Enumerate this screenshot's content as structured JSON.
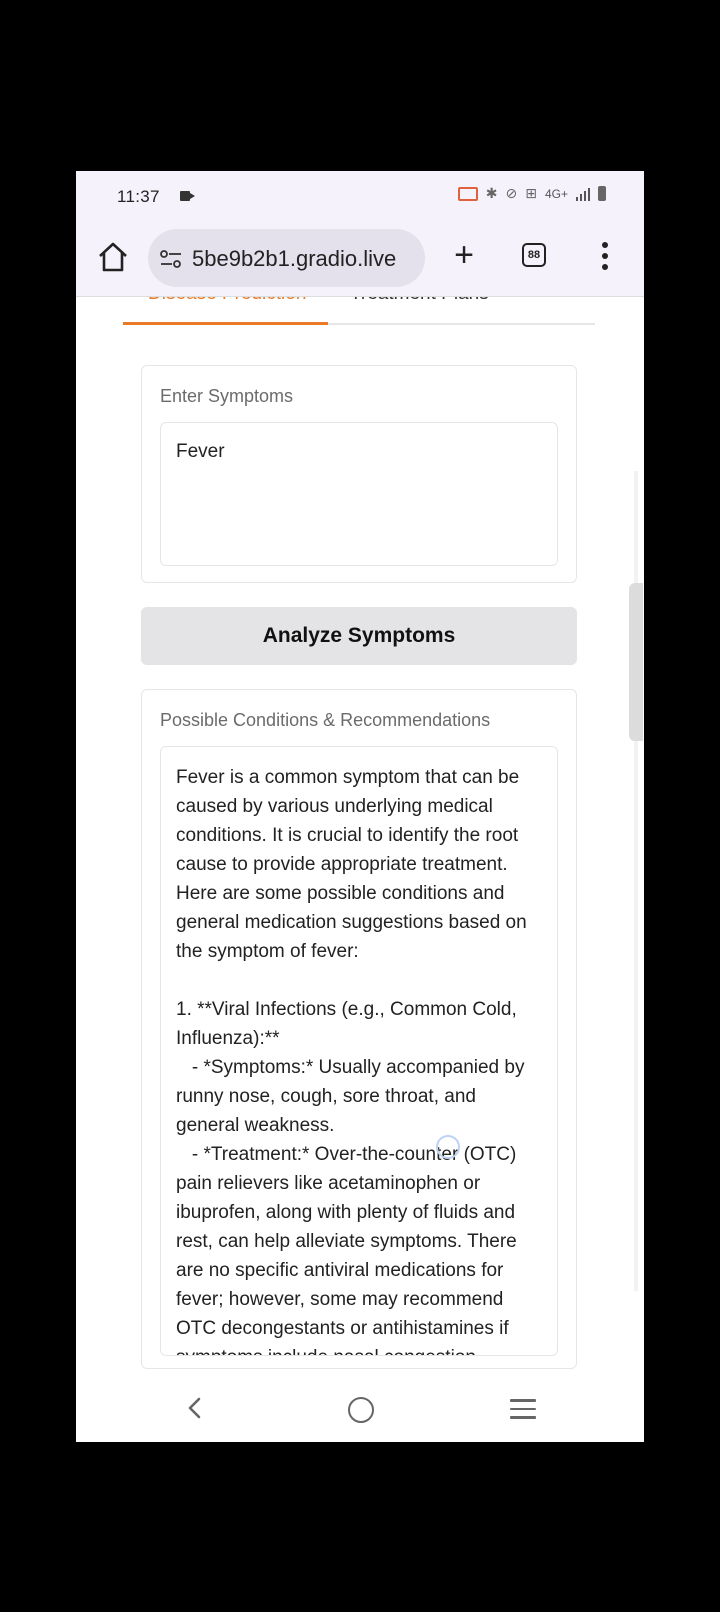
{
  "status_bar": {
    "time": "11:37",
    "network": "4G+"
  },
  "browser": {
    "url": "5be9b2b1.gradio.live",
    "tab_count": "88"
  },
  "tabs": [
    {
      "label": "Disease Prediction",
      "active": true
    },
    {
      "label": "Treatment Plans",
      "active": false
    }
  ],
  "symptoms": {
    "label": "Enter Symptoms",
    "value": "Fever"
  },
  "analyze_button": {
    "label": "Analyze Symptoms"
  },
  "output": {
    "label": "Possible Conditions & Recommendations",
    "text": "Fever is a common symptom that can be caused by various underlying medical conditions. It is crucial to identify the root cause to provide appropriate treatment. Here are some possible conditions and general medication suggestions based on the symptom of fever:\n\n1. **Viral Infections (e.g., Common Cold, Influenza):**\n   - *Symptoms:* Usually accompanied by runny nose, cough, sore throat, and general weakness.\n   - *Treatment:* Over-the-counter (OTC) pain relievers like acetaminophen or ibuprofen, along with plenty of fluids and rest, can help alleviate symptoms. There are no specific antiviral medications for fever; however, some may recommend OTC decongestants or antihistamines if symptoms include nasal congestion."
  },
  "colors": {
    "accent": "#ea7a25",
    "chrome_bg": "#f6f2fc",
    "button_bg": "#e4e4e7"
  }
}
